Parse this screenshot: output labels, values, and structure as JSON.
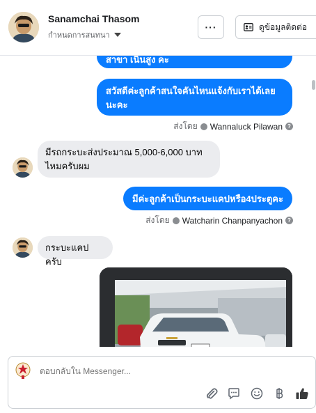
{
  "header": {
    "contact_name": "Sanamchai Thasom",
    "assign_label": "กำหนดการสนทนา",
    "more_label": "···",
    "info_label": "ดูข้อมูลติดต่อ"
  },
  "messages": [
    {
      "type": "outgoing",
      "text": "สาขา เนินสูง คะ"
    },
    {
      "type": "outgoing",
      "line1": "สวัสดีค่ะลูกค้าสนใจคันไหนแจ้งกับเราได้เลย",
      "line2": "นะคะ"
    },
    {
      "type": "sender",
      "prefix": "ส่งโดย",
      "name": "Wannaluck Pilawan"
    },
    {
      "type": "incoming",
      "line1": "มีรถกระบะส่งประมาณ 5,000-6,000 บาท",
      "line2": "ไหมครับผม"
    },
    {
      "type": "outgoing",
      "text": "มีค่ะลูกค้าเป็นกระบะแคปหรือ4ประตูคะ"
    },
    {
      "type": "sender",
      "prefix": "ส่งโดย",
      "name": "Watcharin Chanpanyachon"
    },
    {
      "type": "incoming",
      "text": "กระบะแคปครับ"
    },
    {
      "type": "image"
    }
  ],
  "composer": {
    "placeholder": "ตอบกลับใน Messenger..."
  },
  "colors": {
    "outgoing_bubble": "#0a7cff",
    "incoming_bubble": "#ebecef"
  },
  "icons": [
    "chevron-down-icon",
    "more-icon",
    "contact-card-icon",
    "verified-icon",
    "help-icon",
    "attachment-icon",
    "saved-reply-icon",
    "emoji-icon",
    "baht-icon",
    "like-icon"
  ]
}
